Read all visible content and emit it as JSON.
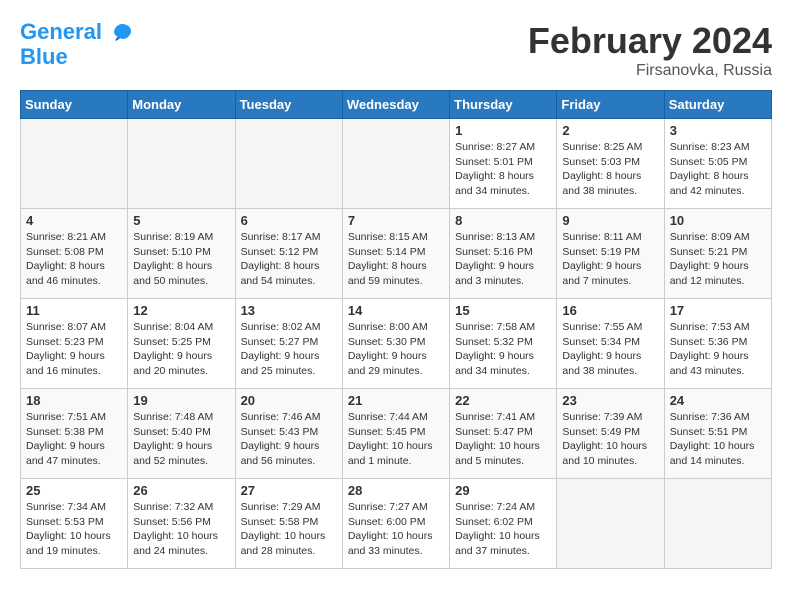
{
  "header": {
    "logo_line1": "General",
    "logo_line2": "Blue",
    "month_title": "February 2024",
    "location": "Firsanovka, Russia"
  },
  "weekdays": [
    "Sunday",
    "Monday",
    "Tuesday",
    "Wednesday",
    "Thursday",
    "Friday",
    "Saturday"
  ],
  "weeks": [
    [
      {
        "day": "",
        "info": ""
      },
      {
        "day": "",
        "info": ""
      },
      {
        "day": "",
        "info": ""
      },
      {
        "day": "",
        "info": ""
      },
      {
        "day": "1",
        "info": "Sunrise: 8:27 AM\nSunset: 5:01 PM\nDaylight: 8 hours\nand 34 minutes."
      },
      {
        "day": "2",
        "info": "Sunrise: 8:25 AM\nSunset: 5:03 PM\nDaylight: 8 hours\nand 38 minutes."
      },
      {
        "day": "3",
        "info": "Sunrise: 8:23 AM\nSunset: 5:05 PM\nDaylight: 8 hours\nand 42 minutes."
      }
    ],
    [
      {
        "day": "4",
        "info": "Sunrise: 8:21 AM\nSunset: 5:08 PM\nDaylight: 8 hours\nand 46 minutes."
      },
      {
        "day": "5",
        "info": "Sunrise: 8:19 AM\nSunset: 5:10 PM\nDaylight: 8 hours\nand 50 minutes."
      },
      {
        "day": "6",
        "info": "Sunrise: 8:17 AM\nSunset: 5:12 PM\nDaylight: 8 hours\nand 54 minutes."
      },
      {
        "day": "7",
        "info": "Sunrise: 8:15 AM\nSunset: 5:14 PM\nDaylight: 8 hours\nand 59 minutes."
      },
      {
        "day": "8",
        "info": "Sunrise: 8:13 AM\nSunset: 5:16 PM\nDaylight: 9 hours\nand 3 minutes."
      },
      {
        "day": "9",
        "info": "Sunrise: 8:11 AM\nSunset: 5:19 PM\nDaylight: 9 hours\nand 7 minutes."
      },
      {
        "day": "10",
        "info": "Sunrise: 8:09 AM\nSunset: 5:21 PM\nDaylight: 9 hours\nand 12 minutes."
      }
    ],
    [
      {
        "day": "11",
        "info": "Sunrise: 8:07 AM\nSunset: 5:23 PM\nDaylight: 9 hours\nand 16 minutes."
      },
      {
        "day": "12",
        "info": "Sunrise: 8:04 AM\nSunset: 5:25 PM\nDaylight: 9 hours\nand 20 minutes."
      },
      {
        "day": "13",
        "info": "Sunrise: 8:02 AM\nSunset: 5:27 PM\nDaylight: 9 hours\nand 25 minutes."
      },
      {
        "day": "14",
        "info": "Sunrise: 8:00 AM\nSunset: 5:30 PM\nDaylight: 9 hours\nand 29 minutes."
      },
      {
        "day": "15",
        "info": "Sunrise: 7:58 AM\nSunset: 5:32 PM\nDaylight: 9 hours\nand 34 minutes."
      },
      {
        "day": "16",
        "info": "Sunrise: 7:55 AM\nSunset: 5:34 PM\nDaylight: 9 hours\nand 38 minutes."
      },
      {
        "day": "17",
        "info": "Sunrise: 7:53 AM\nSunset: 5:36 PM\nDaylight: 9 hours\nand 43 minutes."
      }
    ],
    [
      {
        "day": "18",
        "info": "Sunrise: 7:51 AM\nSunset: 5:38 PM\nDaylight: 9 hours\nand 47 minutes."
      },
      {
        "day": "19",
        "info": "Sunrise: 7:48 AM\nSunset: 5:40 PM\nDaylight: 9 hours\nand 52 minutes."
      },
      {
        "day": "20",
        "info": "Sunrise: 7:46 AM\nSunset: 5:43 PM\nDaylight: 9 hours\nand 56 minutes."
      },
      {
        "day": "21",
        "info": "Sunrise: 7:44 AM\nSunset: 5:45 PM\nDaylight: 10 hours\nand 1 minute."
      },
      {
        "day": "22",
        "info": "Sunrise: 7:41 AM\nSunset: 5:47 PM\nDaylight: 10 hours\nand 5 minutes."
      },
      {
        "day": "23",
        "info": "Sunrise: 7:39 AM\nSunset: 5:49 PM\nDaylight: 10 hours\nand 10 minutes."
      },
      {
        "day": "24",
        "info": "Sunrise: 7:36 AM\nSunset: 5:51 PM\nDaylight: 10 hours\nand 14 minutes."
      }
    ],
    [
      {
        "day": "25",
        "info": "Sunrise: 7:34 AM\nSunset: 5:53 PM\nDaylight: 10 hours\nand 19 minutes."
      },
      {
        "day": "26",
        "info": "Sunrise: 7:32 AM\nSunset: 5:56 PM\nDaylight: 10 hours\nand 24 minutes."
      },
      {
        "day": "27",
        "info": "Sunrise: 7:29 AM\nSunset: 5:58 PM\nDaylight: 10 hours\nand 28 minutes."
      },
      {
        "day": "28",
        "info": "Sunrise: 7:27 AM\nSunset: 6:00 PM\nDaylight: 10 hours\nand 33 minutes."
      },
      {
        "day": "29",
        "info": "Sunrise: 7:24 AM\nSunset: 6:02 PM\nDaylight: 10 hours\nand 37 minutes."
      },
      {
        "day": "",
        "info": ""
      },
      {
        "day": "",
        "info": ""
      }
    ]
  ]
}
